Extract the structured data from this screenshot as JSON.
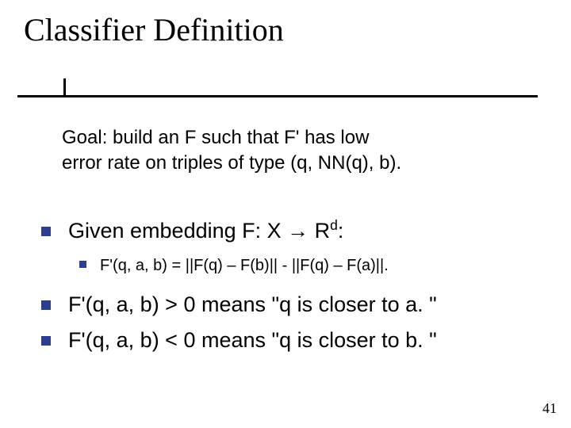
{
  "title": "Classifier Definition",
  "goal_line1": "Goal: build an F such that F' has low",
  "goal_line2": "error rate on triples of type (q, NN(q), b).",
  "bullet_given_prefix": "Given embedding F: X ",
  "bullet_given_suffix_base": " R",
  "bullet_given_sup": "d",
  "bullet_given_end": ":",
  "sub_formula": "F'(q, a, b) = ||F(q) – F(b)|| - ||F(q) – F(a)||.",
  "bullet_pos": "F'(q, a, b) > 0 means \"q is closer to a. \"",
  "bullet_neg": "F'(q, a, b) < 0 means \"q is closer to b. \"",
  "page_number": "41",
  "icons": {
    "arrow_right": "→"
  }
}
